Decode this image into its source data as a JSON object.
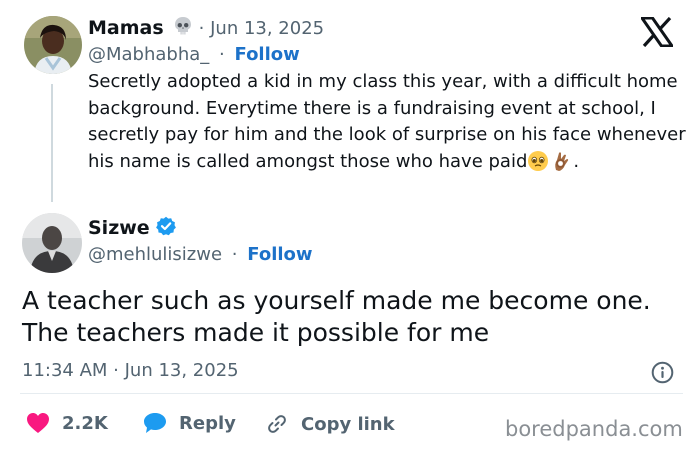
{
  "quoted_post": {
    "author_name": "Mamas",
    "author_emoji_icon": "skull-icon",
    "date": "· Jun 13, 2025",
    "handle": "@Mabhabha_",
    "separator": "·",
    "follow_label": "Follow",
    "text": "Secretly adopted a kid in my class this year, with a difficult home background. Everytime there is a fundraising event at school, I secretly pay for him and the look of surprise on his face whenever his name is called amongst those who have paid",
    "text_end": ".",
    "emojis": [
      "pleading-face-icon",
      "ok-hand-icon"
    ]
  },
  "reply_post": {
    "author_name": "Sizwe",
    "verified": true,
    "handle": "@mehlulisizwe",
    "separator": "·",
    "follow_label": "Follow",
    "text": "A teacher such as yourself made me become one. The teachers made it possible for me",
    "timestamp": "11:34 AM · Jun 13, 2025"
  },
  "actions": {
    "likes_count": "2.2K",
    "reply_label": "Reply",
    "copy_label": "Copy link"
  },
  "branding": {
    "platform_icon": "x-logo-icon",
    "watermark": "boredpanda.com"
  },
  "colors": {
    "like_red": "#f91880",
    "reply_blue": "#1d9bf0",
    "follow_blue": "#1d72c9",
    "verified_blue": "#1d9bf0",
    "muted_gray": "#536471"
  }
}
